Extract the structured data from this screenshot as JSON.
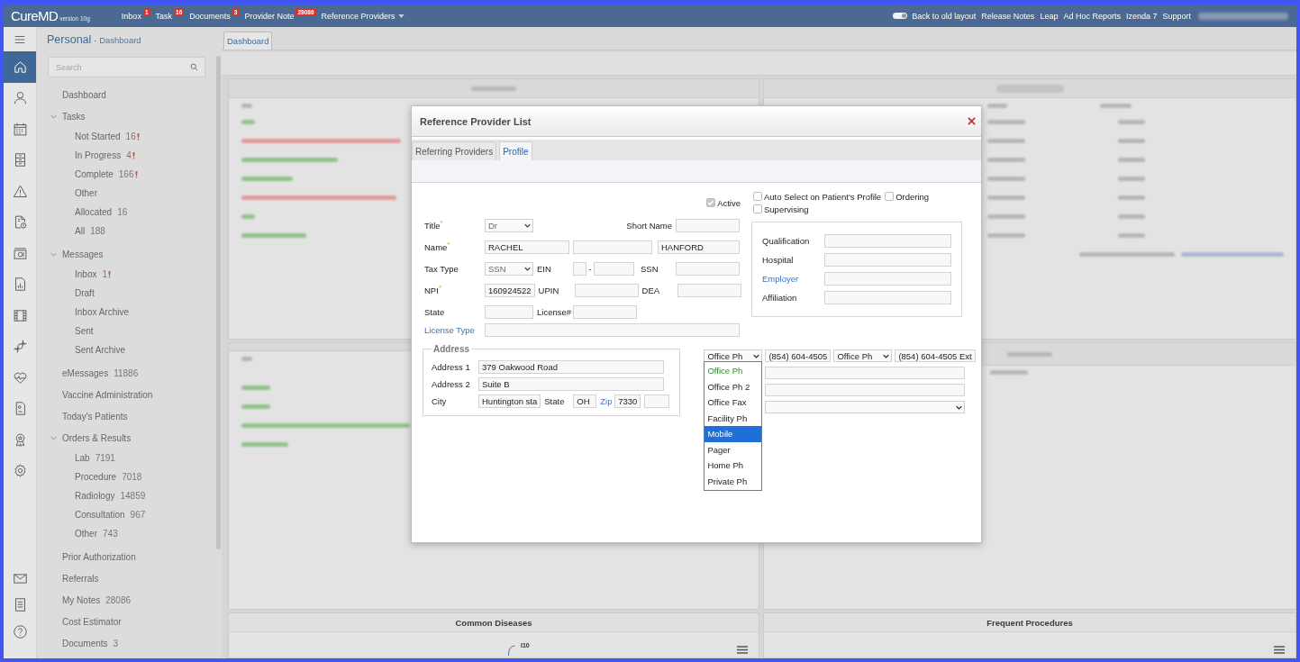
{
  "topbar": {
    "logo": "CureMD",
    "version": "version 10g",
    "nav": [
      {
        "kind": "link",
        "label": "Inbox",
        "badge": "1"
      },
      {
        "kind": "link",
        "label": "Task",
        "badge": "16"
      },
      {
        "kind": "link",
        "label": "Documents",
        "badge": "3"
      },
      {
        "kind": "link",
        "label": "Provider Note",
        "badge": "28086"
      },
      {
        "kind": "menu",
        "label": "Reference Providers"
      }
    ],
    "layout_toggle": {
      "label": "Back to old layout",
      "on": true
    },
    "links": [
      "Release Notes",
      "Leap",
      "Ad Hoc Reports",
      "Izenda 7",
      "Support"
    ]
  },
  "nav_rail": {
    "items": [
      {
        "selected": true
      },
      {
        "selected": false
      },
      {
        "selected": false
      },
      {
        "selected": false
      },
      {
        "selected": false
      },
      {
        "selected": false
      },
      {
        "selected": false
      },
      {
        "selected": false
      },
      {
        "selected": false
      },
      {
        "selected": false
      },
      {
        "selected": false
      },
      {
        "selected": false
      },
      {
        "selected": false
      },
      {
        "selected": false
      }
    ],
    "bottom_items": [
      {
        "selected": false
      },
      {
        "selected": false
      },
      {
        "selected": false
      }
    ]
  },
  "sidebar": {
    "title": "Personal",
    "subtitle": "- Dashboard",
    "search": {
      "placeholder": "Search"
    },
    "items": [
      {
        "kind": "link",
        "label": "Dashboard"
      },
      {
        "kind": "group",
        "label": "Tasks",
        "expanded": true,
        "children": [
          {
            "label": "Not Started",
            "count": "16",
            "flagged": true
          },
          {
            "label": "In Progress",
            "count": "4",
            "flagged": true
          },
          {
            "label": "Complete",
            "count": "166",
            "flagged": true
          },
          {
            "label": "Other",
            "flagged": false
          },
          {
            "label": "Allocated",
            "count": "16",
            "flagged": false
          },
          {
            "label": "All",
            "count": "188",
            "flagged": false
          }
        ]
      },
      {
        "kind": "group",
        "label": "Messages",
        "expanded": true,
        "children": [
          {
            "label": "Inbox",
            "count": "1",
            "flagged": true
          },
          {
            "label": "Draft",
            "flagged": false
          },
          {
            "label": "Inbox Archive",
            "flagged": false
          },
          {
            "label": "Sent",
            "flagged": false
          },
          {
            "label": "Sent Archive",
            "flagged": false
          }
        ]
      },
      {
        "kind": "link",
        "label": "eMessages",
        "count": "11886"
      },
      {
        "kind": "link",
        "label": "Vaccine Administration"
      },
      {
        "kind": "link",
        "label": "Today's Patients"
      },
      {
        "kind": "group",
        "label": "Orders & Results",
        "expanded": true,
        "children": [
          {
            "label": "Lab",
            "count": "7191",
            "flagged": false
          },
          {
            "label": "Procedure",
            "count": "7018",
            "flagged": false
          },
          {
            "label": "Radiology",
            "count": "14859",
            "flagged": false
          },
          {
            "label": "Consultation",
            "count": "967",
            "flagged": false
          },
          {
            "label": "Other",
            "count": "743",
            "flagged": false
          }
        ]
      },
      {
        "kind": "link",
        "label": "Prior Authorization"
      },
      {
        "kind": "link",
        "label": "Referrals"
      },
      {
        "kind": "link",
        "label": "My Notes",
        "count": "28086"
      },
      {
        "kind": "link",
        "label": "Cost Estimator"
      },
      {
        "kind": "link",
        "label": "Documents",
        "count": "3"
      }
    ]
  },
  "main_tabs": [
    {
      "label": "Dashboard",
      "selected": true
    }
  ],
  "bottom_panels": [
    {
      "title": "Common Diseases",
      "chart_labels": [
        "I10"
      ]
    },
    {
      "title": "Frequent Procedures"
    }
  ],
  "modal": {
    "title": "Reference Provider List",
    "tabs": [
      {
        "label": "Referring Providers",
        "selected": false
      },
      {
        "label": "Profile",
        "selected": true
      }
    ],
    "active": {
      "label": "Active",
      "checked": true,
      "disabled": true
    },
    "flags": [
      {
        "label": "Auto Select on Patient's Profile",
        "checked": false
      },
      {
        "label": "Ordering",
        "checked": false
      },
      {
        "label": "Supervising",
        "checked": false
      }
    ],
    "form": {
      "title": {
        "label": "Title$^{*}$",
        "value": "Dr"
      },
      "short_name": {
        "label": "Short Name"
      },
      "name": {
        "label": "Name$^{*}$",
        "first": "RACHEL",
        "last": "HANFORD"
      },
      "tax_type": {
        "label": "Tax Type",
        "value": "SSN"
      },
      "ein": {
        "label": "EIN",
        "separator": "-"
      },
      "ssn": {
        "label": "SSN"
      },
      "npi": {
        "label": "NPI$^{*}$",
        "value": "160924522"
      },
      "upin": {
        "label": "UPIN"
      },
      "dea": {
        "label": "DEA"
      },
      "state": {
        "label": "State"
      },
      "license": {
        "label": "License#"
      },
      "license_type": {
        "label": "License Type"
      }
    },
    "details": [
      {
        "label": "Qualification",
        "link": false
      },
      {
        "label": "Hospital",
        "link": false
      },
      {
        "label": "Employer",
        "link": true
      },
      {
        "label": "Affiliation",
        "link": false
      }
    ],
    "address": {
      "legend": "Address",
      "line1": {
        "label": "Address 1",
        "value": "379 Oakwood Road"
      },
      "line2": {
        "label": "Address 2",
        "value": "Suite B"
      },
      "city": {
        "label": "City",
        "value": "Huntington sta"
      },
      "state": {
        "label": "State",
        "value": "OH"
      },
      "zip": {
        "label": "Zip",
        "value": "7330"
      }
    },
    "phones": [
      {
        "type": "Office Ph",
        "number": "(854) 604-4505"
      },
      {
        "type": "Office Ph",
        "number": "(854) 604-4505 Ext"
      }
    ],
    "phone_type_menu": {
      "options": [
        {
          "label": "Office Ph",
          "current": true,
          "selected": false
        },
        {
          "label": "Office Ph 2",
          "current": false,
          "selected": false
        },
        {
          "label": "Office Fax",
          "current": false,
          "selected": false
        },
        {
          "label": "Facility Ph",
          "current": false,
          "selected": false
        },
        {
          "label": "Mobile",
          "current": false,
          "selected": true
        },
        {
          "label": "Pager",
          "current": false,
          "selected": false
        },
        {
          "label": "Home Ph",
          "current": false,
          "selected": false
        },
        {
          "label": "Private Ph",
          "current": false,
          "selected": false
        }
      ]
    }
  }
}
